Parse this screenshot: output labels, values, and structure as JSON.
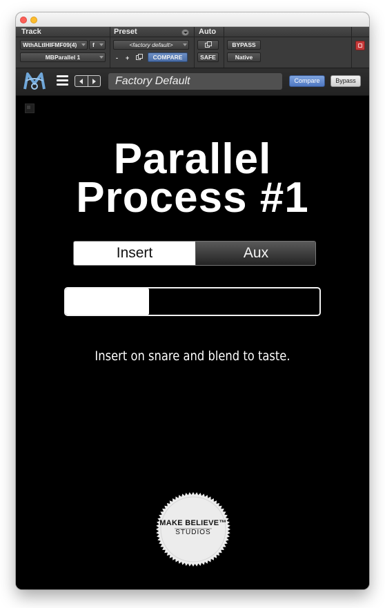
{
  "window": {
    "controls": [
      "close",
      "minimize"
    ]
  },
  "protools_header": {
    "labels": {
      "track": "Track",
      "preset": "Preset",
      "auto": "Auto"
    },
    "track_name": "WthALtIHIFMF09(4)",
    "track_mode": "f",
    "insert_name": "MBParallel 1",
    "preset_value": "<factory default>",
    "minus_label": "-",
    "plus_label": "+",
    "compare_label": "COMPARE",
    "bypass_label": "BYPASS",
    "safe_label": "SAFE",
    "format_label": "Native"
  },
  "plugin_toolbar": {
    "preset_name": "Factory Default",
    "compare_label": "Compare",
    "bypass_label": "Bypass"
  },
  "plugin": {
    "title_line1": "Parallel",
    "title_line2": "Process #1",
    "mode_options": [
      "Insert",
      "Aux"
    ],
    "selected_mode": "Insert",
    "blend_level": 0.33,
    "description": "Insert on snare and blend to taste.",
    "badge": {
      "line1": "MAKE BELIEVE™",
      "line2": "STUDIOS"
    }
  },
  "colors": {
    "background": "#000000",
    "compare_accent": "#5a82c8",
    "power_button": "#c53a3a"
  }
}
